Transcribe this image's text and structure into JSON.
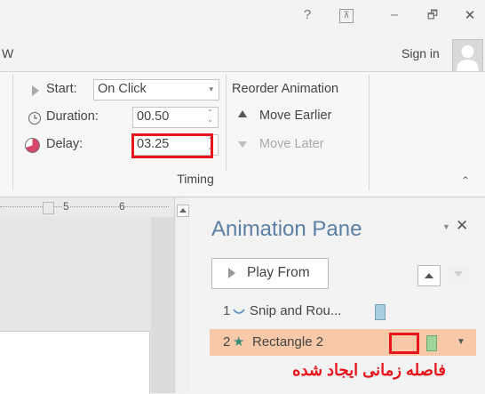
{
  "window": {
    "help": "?",
    "ribbon_display": "⊼",
    "minimize": "–",
    "restore": "🗗",
    "close": "✕"
  },
  "tabs": {
    "partial_tab": "W",
    "sign_in": "Sign in"
  },
  "timing": {
    "start_label": "Start:",
    "start_value": "On Click",
    "duration_label": "Duration:",
    "duration_value": "00.50",
    "delay_label": "Delay:",
    "delay_value": "03.25",
    "group_label": "Timing",
    "reorder_title": "Reorder Animation",
    "move_earlier": "Move Earlier",
    "move_later": "Move Later"
  },
  "ruler": {
    "mark5": "5",
    "mark6": "6"
  },
  "animation_pane": {
    "title": "Animation Pane",
    "play_from": "Play From",
    "items": [
      {
        "number": "1",
        "name": "Snip and Rou...",
        "selected": false
      },
      {
        "number": "2",
        "name": "Rectangle 2",
        "selected": true
      }
    ],
    "annotation": "فاصله زمانی ایجاد شده"
  },
  "colors": {
    "highlight": "#e8141c",
    "selected_row": "#f8c9a9",
    "timing_bar": "#9fd59a",
    "pane_title": "#5b7fa6",
    "annotation": "#e8141c"
  }
}
